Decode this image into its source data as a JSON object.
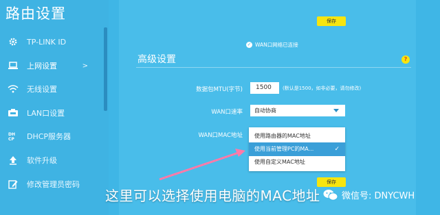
{
  "sidebar": {
    "title": "路由设置",
    "items": [
      {
        "label": "TP-LINK ID",
        "icon": "gear-icon"
      },
      {
        "label": "上网设置",
        "icon": "laptop-icon",
        "chevron": ">"
      },
      {
        "label": "无线设置",
        "icon": "wifi-icon"
      },
      {
        "label": "LAN口设置",
        "icon": "lan-icon"
      },
      {
        "label": "DHCP服务器",
        "icon": "dhcp-icon"
      },
      {
        "label": "软件升级",
        "icon": "upload-icon"
      },
      {
        "label": "修改管理员密码",
        "icon": "edit-icon"
      }
    ]
  },
  "main": {
    "save_top": "保存",
    "status": "WAN口网络已连接",
    "section_title": "高级设置",
    "help": "?",
    "mtu_label": "数据包MTU(字节)",
    "mtu_value": "1500",
    "mtu_hint": "(默认是1500，如非必要，请勿修改)",
    "wan_speed_label": "WAN口速率",
    "wan_speed_value": "自动协商",
    "wan_mac_label": "WAN口MAC地址",
    "mac_options": [
      {
        "label": "使用路由器的MAC地址",
        "selected": false
      },
      {
        "label": "使用当前管理PC的MA...",
        "selected": true
      },
      {
        "label": "使用自定义MAC地址",
        "selected": false
      }
    ],
    "save_bottom": "保存"
  },
  "overlay": {
    "caption": "这里可以选择使用电脑的MAC地址",
    "watermark": "微信号: DNYCWH"
  },
  "colors": {
    "background": "#3fb6e6",
    "save_button": "#f7e50f",
    "selected_option": "#3a9fd8",
    "arrow": "#ff7aa8"
  }
}
